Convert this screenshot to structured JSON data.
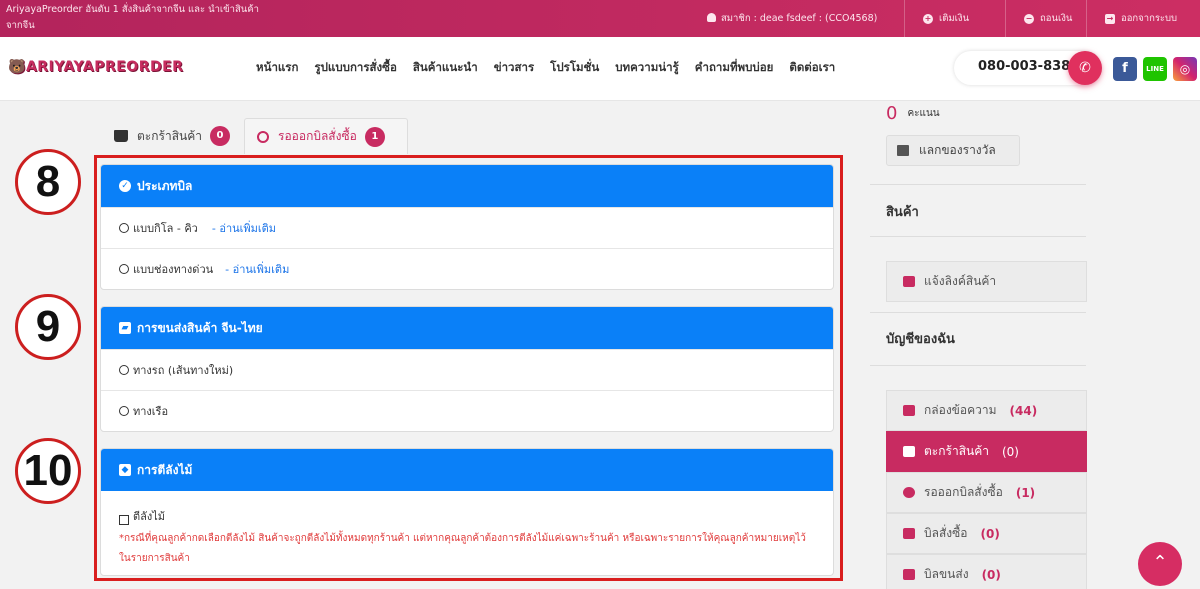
{
  "topbar": {
    "tagline": "AriyayaPreorder อันดับ 1 สั่งสินค้าจากจีน และ นำเข้าสินค้าจากจีน",
    "member": "สมาชิก : deae fsdeef : (CCO4568)",
    "deposit": "เติมเงิน",
    "withdraw": "ถอนเงิน",
    "logout": "ออกจากระบบ"
  },
  "nav": {
    "logo": "ARIYAYAPREORDER",
    "menu": [
      "หน้าแรก",
      "รูปแบบการสั่งซื้อ",
      "สินค้าแนะนำ",
      "ข่าวสาร",
      "โปรโมชั่น",
      "บทความน่ารู้",
      "คำถามที่พบบ่อย",
      "ติดต่อเรา"
    ],
    "phone": "080-003-8383",
    "line_label": "LINE"
  },
  "tabs": {
    "cart": {
      "label": "ตะกร้าสินค้า",
      "count": "0"
    },
    "pending": {
      "label": "รอออกบิลสั่งซื้อ",
      "count": "1"
    }
  },
  "steps": [
    "8",
    "9",
    "10"
  ],
  "bill_type": {
    "title": "ประเภทบิล",
    "options": [
      {
        "label": "แบบกิโล - คิว",
        "more": "- อ่านเพิ่มเติม"
      },
      {
        "label": "แบบช่องทางด่วน",
        "more": "- อ่านเพิ่มเติม"
      }
    ]
  },
  "shipping": {
    "title": "การขนส่งสินค้า จีน-ไทย",
    "options": [
      "ทางรถ (เส้นทางใหม่)",
      "ทางเรือ"
    ]
  },
  "crate": {
    "title": "การตีลังไม้",
    "option": "ตีลังไม้",
    "note": "*กรณีที่คุณลูกค้ากดเลือกตีลังไม้ สินค้าจะถูกตีลังไม้ทั้งหมดทุกร้านค้า แต่หากคุณลูกค้าต้องการตีลังไม้แค่เฉพาะร้านค้า หรือเฉพาะรายการให้คุณลูกค้าหมายเหตุไว้ในรายการสินค้า"
  },
  "sidebar": {
    "points": "0",
    "points_label": "คะแนน",
    "redeem": "แลกของรางวัล",
    "products_title": "สินค้า",
    "notify_link": "แจ้งลิงค์สินค้า",
    "account_title": "บัญชีของฉัน",
    "items": [
      {
        "label": "กล่องข้อความ",
        "count": "(44)"
      },
      {
        "label": "ตะกร้าสินค้า",
        "count": "(0)"
      },
      {
        "label": "รอออกบิลสั่งซื้อ",
        "count": "(1)"
      },
      {
        "label": "บิลสั่งซื้อ",
        "count": "(0)"
      },
      {
        "label": "บิลขนส่ง",
        "count": "(0)"
      }
    ]
  },
  "colors": {
    "brand": "#c82b61",
    "panel_header": "#0a80f8",
    "highlight": "#d91e1e"
  }
}
